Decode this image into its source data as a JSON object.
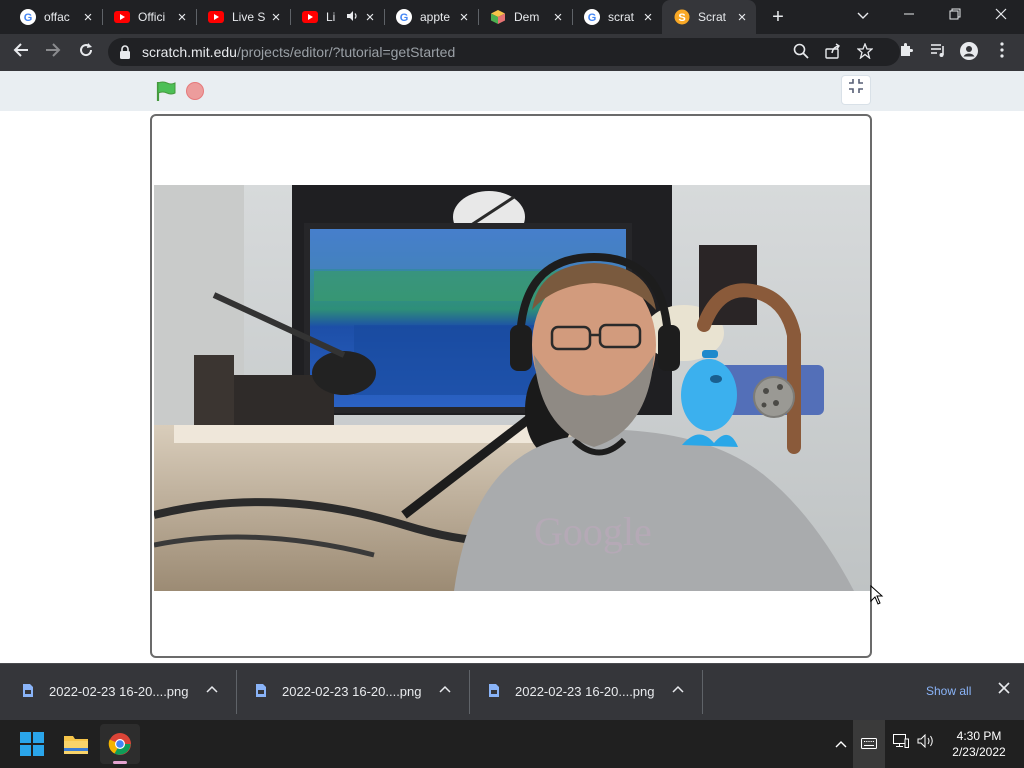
{
  "browser": {
    "tabs": [
      {
        "title": "offac",
        "favicon": "google-icon"
      },
      {
        "title": "Offici",
        "favicon": "youtube-icon"
      },
      {
        "title": "Live S",
        "favicon": "youtube-icon"
      },
      {
        "title": "Li",
        "favicon": "youtube-icon",
        "audio": true
      },
      {
        "title": "appte",
        "favicon": "google-icon"
      },
      {
        "title": "Dem",
        "favicon": "box-icon"
      },
      {
        "title": "scrat",
        "favicon": "google-icon"
      },
      {
        "title": "Scrat",
        "favicon": "scratch-icon",
        "active": true
      }
    ],
    "url_host": "scratch.mit.edu",
    "url_path": "/projects/editor/?tutorial=getStarted"
  },
  "downloads": {
    "items": [
      {
        "name": "2022-02-23 16-20....png"
      },
      {
        "name": "2022-02-23 16-20....png"
      },
      {
        "name": "2022-02-23 16-20....png"
      }
    ],
    "show_all": "Show all"
  },
  "taskbar": {
    "time": "4:30 PM",
    "date": "2/23/2022"
  },
  "colors": {
    "chrome_dark": "#202124",
    "chrome_toolbar": "#35363a",
    "scratch_header": "#e9eef2",
    "flag_green": "#4cbf56",
    "stop_red": "#ec9c9c",
    "link_blue": "#8ab4f8"
  }
}
